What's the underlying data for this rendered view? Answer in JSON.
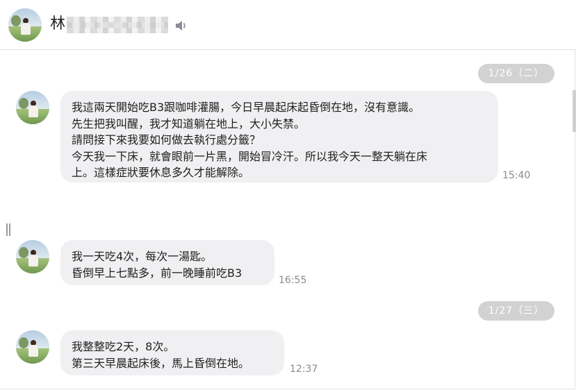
{
  "header": {
    "contact_name_visible": "林"
  },
  "dates": {
    "d1": "1/26（二）",
    "d2": "1/27（三）"
  },
  "messages": [
    {
      "lines": [
        "我這兩天開始吃B3跟咖啡灌腸，今日早晨起床起昏倒在地，沒有意識。",
        "先生把我叫醒，我才知道躺在地上，大小失禁。",
        "請問接下來我要如何做去執行處分籤？",
        "今天我一下床，就會眼前一片黑，開始冒冷汗。所以我今天一整天躺在床",
        "上。這樣症狀要休息多久才能解除。"
      ],
      "time": "15:40"
    },
    {
      "lines": [
        "我一天吃4次，每次一湯匙。",
        "昏倒早上七點多，前一晚睡前吃B3"
      ],
      "time": "16:55"
    },
    {
      "lines": [
        "我整整吃2天，8次。",
        "第三天早晨起床後，馬上昏倒在地。"
      ],
      "time": "12:37"
    }
  ]
}
